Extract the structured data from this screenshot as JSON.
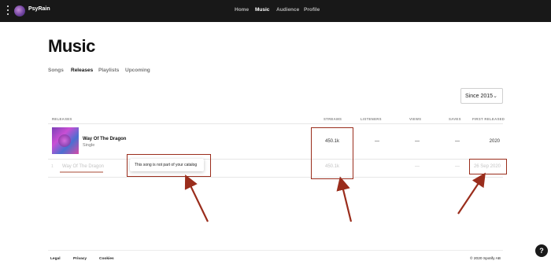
{
  "topbar": {
    "artist_name": "PsyRain",
    "nav": [
      "Home",
      "Music",
      "Audience",
      "Profile"
    ],
    "active_nav": "Music"
  },
  "page": {
    "title": "Music",
    "tabs": [
      "Songs",
      "Releases",
      "Playlists",
      "Upcoming"
    ],
    "active_tab": "Releases",
    "filter": {
      "selected": "Since 2015"
    }
  },
  "table": {
    "headers": {
      "releases": "RELEASES",
      "streams": "STREAMS",
      "listeners": "LISTENERS",
      "views": "VIEWS",
      "saves": "SAVES",
      "first_released": "FIRST RELEASED"
    },
    "rows": [
      {
        "title": "Way Of The Dragon",
        "type": "Single",
        "streams": "450.1k",
        "listeners": "—",
        "views": "—",
        "saves": "—",
        "first_released": "2020"
      },
      {
        "index": "1",
        "title": "Way Of The Dragon",
        "streams": "450.1k",
        "views": "—",
        "saves": "—",
        "first_released": "26 Sep 2020"
      }
    ],
    "tooltip": "This song is not part of your catalog"
  },
  "footer": {
    "links": [
      "Legal",
      "Privacy",
      "Cookies"
    ],
    "copyright": "© 2020 Spotify AB",
    "help_label": "?"
  },
  "colors": {
    "topbar_bg": "#181818",
    "annotation": "#9a2d1c"
  }
}
